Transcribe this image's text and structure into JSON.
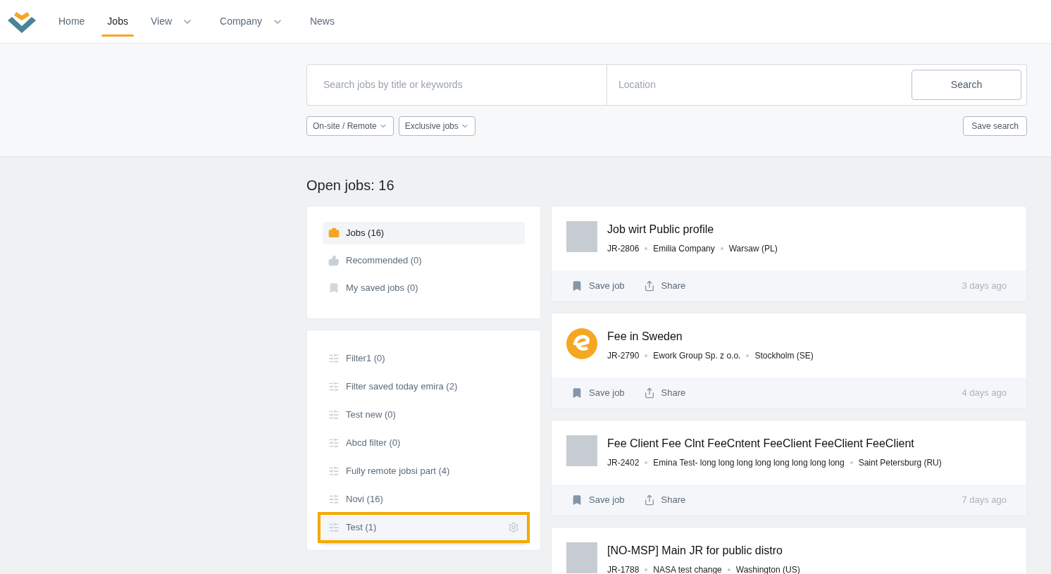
{
  "nav": {
    "items": [
      {
        "label": "Home",
        "selected": false,
        "dropdown": false
      },
      {
        "label": "Jobs",
        "selected": true,
        "dropdown": false
      },
      {
        "label": "View",
        "selected": false,
        "dropdown": true
      },
      {
        "label": "Company",
        "selected": false,
        "dropdown": true
      },
      {
        "label": "News",
        "selected": false,
        "dropdown": false
      }
    ]
  },
  "search": {
    "keywords_placeholder": "Search jobs by title or keywords",
    "location_placeholder": "Location",
    "button": "Search"
  },
  "filters": [
    {
      "label": "On-site / Remote"
    },
    {
      "label": "Exclusive jobs"
    }
  ],
  "save_search": "Save search",
  "heading": "Open jobs: 16",
  "lists": [
    {
      "label": "Jobs (16)",
      "kind": "briefcase",
      "selected": true
    },
    {
      "label": "Recommended (0)",
      "kind": "thumb",
      "selected": false
    },
    {
      "label": "My saved jobs (0)",
      "kind": "bookmark",
      "selected": false
    }
  ],
  "saved_filters": [
    {
      "label": "Filter1 (0)",
      "highlighted": false
    },
    {
      "label": "Filter saved today emira (2)",
      "highlighted": false
    },
    {
      "label": "Test new (0)",
      "highlighted": false
    },
    {
      "label": "Abcd filter (0)",
      "highlighted": false
    },
    {
      "label": "Fully remote jobsi part (4)",
      "highlighted": false
    },
    {
      "label": "Novi (16)",
      "highlighted": false
    },
    {
      "label": "Test (1)",
      "highlighted": true
    }
  ],
  "jobs": [
    {
      "title": "Job wirt Public profile",
      "id": "JR-2806",
      "company": "Emilia Company",
      "location": "Warsaw (PL)",
      "logo": {
        "kind": "photo"
      },
      "save": "Save job",
      "share": "Share",
      "age": "3 days ago"
    },
    {
      "title": "Fee in Sweden",
      "id": "JR-2790",
      "company": "Ework Group Sp. z o.o.",
      "location": "Stockholm (SE)",
      "logo": {
        "kind": "emblem"
      },
      "save": "Save job",
      "share": "Share",
      "age": "4 days ago"
    },
    {
      "title": "Fee Client Fee Clnt FeeCntent FeeClient FeeClient FeeClient",
      "id": "JR-2402",
      "company": "Emina Test- long long long long long long long long",
      "location": "Saint Petersburg (RU)",
      "logo": {
        "kind": "photo"
      },
      "save": "Save job",
      "share": "Share",
      "age": "7 days ago"
    },
    {
      "title": "[NO-MSP] Main JR for public distro",
      "id": "JR-1788",
      "company": "NASA test change",
      "location": "Washington (US)",
      "logo": {
        "kind": "photo"
      }
    }
  ]
}
